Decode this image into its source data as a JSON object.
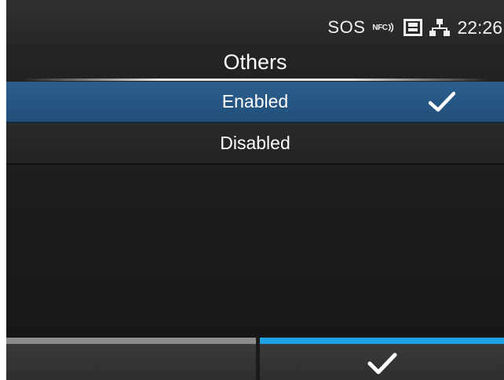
{
  "status_bar": {
    "sos": "SOS",
    "nfc": "NFC",
    "time": "22:26",
    "icons": [
      "nfc-icon",
      "sd-card-icon",
      "network-icon"
    ]
  },
  "title": "Others",
  "options": [
    {
      "label": "Enabled",
      "selected": true
    },
    {
      "label": "Disabled",
      "selected": false
    }
  ],
  "softkeys": {
    "left": {
      "label": "",
      "accent": "#8c8c8c"
    },
    "right": {
      "icon": "check-icon",
      "accent": "#1ea4e6"
    }
  },
  "colors": {
    "selection": "#2c5f8e",
    "accent": "#1ea4e6"
  }
}
